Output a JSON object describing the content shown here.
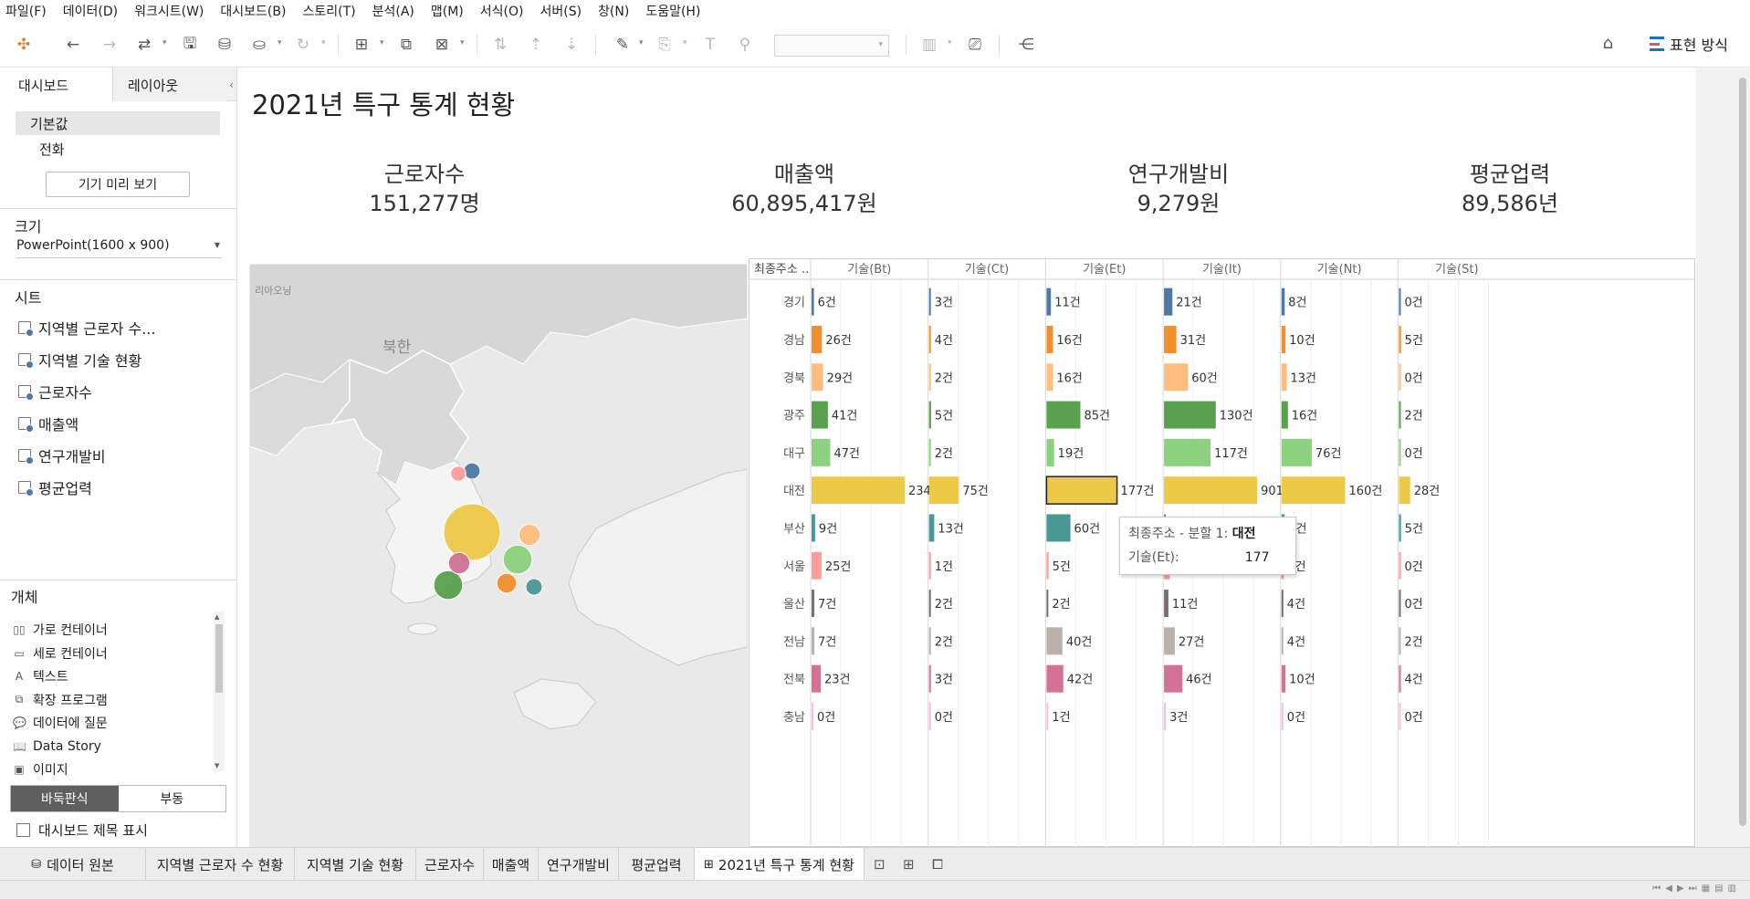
{
  "menu": [
    "파일(F)",
    "데이터(D)",
    "워크시트(W)",
    "대시보드(B)",
    "스토리(T)",
    "분석(A)",
    "맵(M)",
    "서식(O)",
    "서버(S)",
    "창(N)",
    "도움말(H)"
  ],
  "toolbar": {
    "present_label": "표현 방식",
    "icons": [
      "tableau-logo-icon",
      "undo-icon",
      "redo-icon",
      "replay-icon",
      "save-icon",
      "new-datasource-icon",
      "pause-icon",
      "refresh-icon",
      "new-worksheet-icon",
      "duplicate-icon",
      "clear-icon",
      "swap-icon",
      "sort-asc-icon",
      "sort-desc-icon",
      "highlight-icon",
      "group-icon",
      "label-icon",
      "fix-axes-icon",
      "show-me-icon",
      "presentation-icon",
      "share-icon",
      "format-brush-icon"
    ]
  },
  "left_panel": {
    "tab_dashboard": "대시보드",
    "tab_layout": "레이아웃",
    "devices": [
      "기본값",
      "전화"
    ],
    "device_preview_button": "기기 미리 보기",
    "size_title": "크기",
    "size_value": "PowerPoint(1600 x 900)",
    "sheets_title": "시트",
    "sheets": [
      "지역별 근로자 수...",
      "지역별 기술 현황",
      "근로자수",
      "매출액",
      "연구개발비",
      "평균업력"
    ],
    "objects_title": "개체",
    "objects": [
      {
        "icon": "horizontal-container-icon",
        "glyph": "▯▯",
        "label": "가로 컨테이너"
      },
      {
        "icon": "vertical-container-icon",
        "glyph": "▭",
        "label": "세로 컨테이너"
      },
      {
        "icon": "text-icon",
        "glyph": "A",
        "label": "텍스트"
      },
      {
        "icon": "extension-icon",
        "glyph": "⧉",
        "label": "확장 프로그램"
      },
      {
        "icon": "ask-data-icon",
        "glyph": "💬",
        "label": "데이터에 질문"
      },
      {
        "icon": "data-story-icon",
        "glyph": "📖",
        "label": "Data Story"
      },
      {
        "icon": "image-icon",
        "glyph": "▣",
        "label": "이미지"
      }
    ],
    "layout_tiled": "바둑판식",
    "layout_floating": "부동",
    "show_title_label": "대시보드 제목 표시"
  },
  "dashboard": {
    "title": "2021년 특구 통계 현황",
    "kpis": [
      {
        "label": "근로자수",
        "value": "151,277명"
      },
      {
        "label": "매출액",
        "value": "60,895,417원"
      },
      {
        "label": "연구개발비",
        "value": "9,279원"
      },
      {
        "label": "평균업력",
        "value": "89,586년"
      }
    ]
  },
  "map": {
    "labels": {
      "liaoning": "리아오닝",
      "north_korea": "북한"
    },
    "bubbles": [
      {
        "region": "대전",
        "color": "#edc948",
        "value": 1468
      },
      {
        "region": "광주",
        "color": "#59a14f",
        "value": 279
      },
      {
        "region": "대구",
        "color": "#8cd17d",
        "value": 279
      },
      {
        "region": "부산",
        "color": "#499894",
        "value": 50
      },
      {
        "region": "전북",
        "color": "#d37295",
        "value": 120
      },
      {
        "region": "경기",
        "color": "#4e79a7",
        "value": 49
      },
      {
        "region": "경북",
        "color": "#ffbe7d",
        "value": 120
      },
      {
        "region": "경남",
        "color": "#f28e2b",
        "value": 92
      },
      {
        "region": "서울",
        "color": "#ff9d9a",
        "value": 37
      }
    ]
  },
  "table": {
    "row_header": "최종주소 ..",
    "columns": [
      "기술(Bt)",
      "기술(Ct)",
      "기술(Et)",
      "기술(It)",
      "기술(Nt)",
      "기술(St)"
    ],
    "unit": "건",
    "rows": [
      {
        "region": "경기",
        "color": "#4e79a7",
        "values": [
          6,
          3,
          11,
          21,
          8,
          0
        ]
      },
      {
        "region": "경남",
        "color": "#f28e2b",
        "values": [
          26,
          4,
          16,
          31,
          10,
          5
        ]
      },
      {
        "region": "경북",
        "color": "#ffbe7d",
        "values": [
          29,
          2,
          16,
          60,
          13,
          0
        ]
      },
      {
        "region": "광주",
        "color": "#59a14f",
        "values": [
          41,
          5,
          85,
          130,
          16,
          2
        ]
      },
      {
        "region": "대구",
        "color": "#8cd17d",
        "values": [
          47,
          2,
          19,
          117,
          76,
          0
        ]
      },
      {
        "region": "대전",
        "color": "#edc948",
        "values": [
          234,
          75,
          177,
          901,
          160,
          28
        ]
      },
      {
        "region": "부산",
        "color": "#499894",
        "values": [
          9,
          13,
          60,
          0,
          8,
          5
        ]
      },
      {
        "region": "서울",
        "color": "#ff9d9a",
        "values": [
          25,
          1,
          5,
          15,
          6,
          0
        ]
      },
      {
        "region": "울산",
        "color": "#79706e",
        "values": [
          7,
          2,
          2,
          11,
          4,
          0
        ]
      },
      {
        "region": "전남",
        "color": "#bab0ac",
        "values": [
          7,
          2,
          40,
          27,
          4,
          2
        ]
      },
      {
        "region": "전북",
        "color": "#d37295",
        "values": [
          23,
          3,
          42,
          46,
          10,
          4
        ]
      },
      {
        "region": "충남",
        "color": "#fabfd2",
        "values": [
          0,
          0,
          1,
          3,
          0,
          0
        ]
      }
    ],
    "tooltip": {
      "field1_label": "최종주소 - 분할 1:",
      "field1_value": "대전",
      "field2_label": "기술(Et):",
      "field2_value": "177"
    }
  },
  "bottom_tabs": {
    "datasource": "데이터 원본",
    "sheets": [
      "지역별 근로자 수 현황",
      "지역별 기술 현황",
      "근로자수",
      "매출액",
      "연구개발비",
      "평균업력"
    ],
    "active": "2021년 특구 통계 현황"
  }
}
